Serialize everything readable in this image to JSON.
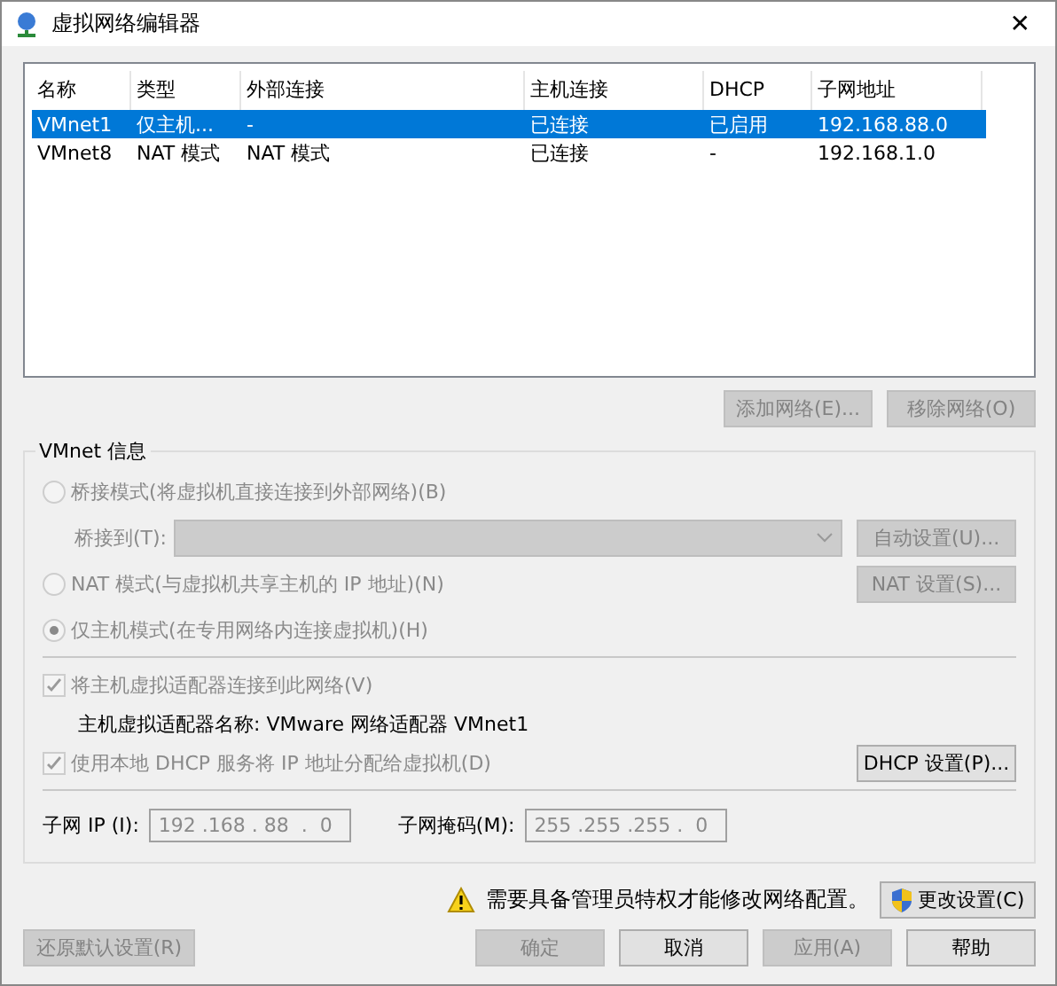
{
  "window": {
    "title": "虚拟网络编辑器",
    "close": "✕"
  },
  "table": {
    "columns": [
      "名称",
      "类型",
      "外部连接",
      "主机连接",
      "DHCP",
      "子网地址"
    ],
    "rows": [
      {
        "cells": [
          "VMnet1",
          "仅主机...",
          "-",
          "已连接",
          "已启用",
          "192.168.88.0"
        ],
        "selected": true
      },
      {
        "cells": [
          "VMnet8",
          "NAT 模式",
          "NAT 模式",
          "已连接",
          "-",
          "192.168.1.0"
        ],
        "selected": false
      }
    ]
  },
  "list_buttons": [
    {
      "label": "添加网络(E)...",
      "disabled": true
    },
    {
      "label": "移除网络(O)",
      "disabled": true
    }
  ],
  "group": {
    "title": "VMnet 信息",
    "modes": [
      {
        "label": "桥接模式(将虚拟机直接连接到外部网络)(B)",
        "selected": false
      },
      {
        "label": "NAT 模式(与虚拟机共享主机的 IP 地址)(N)",
        "selected": false
      },
      {
        "label": "仅主机模式(在专用网络内连接虚拟机)(H)",
        "selected": true
      }
    ],
    "bridge_label": "桥接到(T):",
    "auto_button": {
      "label": "自动设置(U)...",
      "disabled": true
    },
    "nat_button": {
      "label": "NAT 设置(S)...",
      "disabled": true
    },
    "connect_adapter": {
      "label": "将主机虚拟适配器连接到此网络(V)",
      "checked": true
    },
    "adapter_name": "主机虚拟适配器名称: VMware 网络适配器 VMnet1",
    "use_dhcp": {
      "label": "使用本地 DHCP 服务将 IP 地址分配给虚拟机(D)",
      "checked": true
    },
    "dhcp_button": {
      "label": "DHCP 设置(P)...",
      "disabled": false
    },
    "subnet_ip": {
      "label": "子网 IP (I):",
      "value": "192 .168 . 88  .  0"
    },
    "subnet_mask": {
      "label": "子网掩码(M):",
      "value": "255 .255 .255 .  0"
    }
  },
  "warning": "需要具备管理员特权才能修改网络配置。",
  "change_button": {
    "label": "更改设置(C)",
    "disabled": false
  },
  "restore_button": {
    "label": "还原默认设置(R)",
    "disabled": true
  },
  "bottom_buttons": [
    {
      "label": "确定",
      "disabled": true
    },
    {
      "label": "取消",
      "disabled": false
    },
    {
      "label": "应用(A)",
      "disabled": true
    },
    {
      "label": "帮助",
      "disabled": false
    }
  ]
}
